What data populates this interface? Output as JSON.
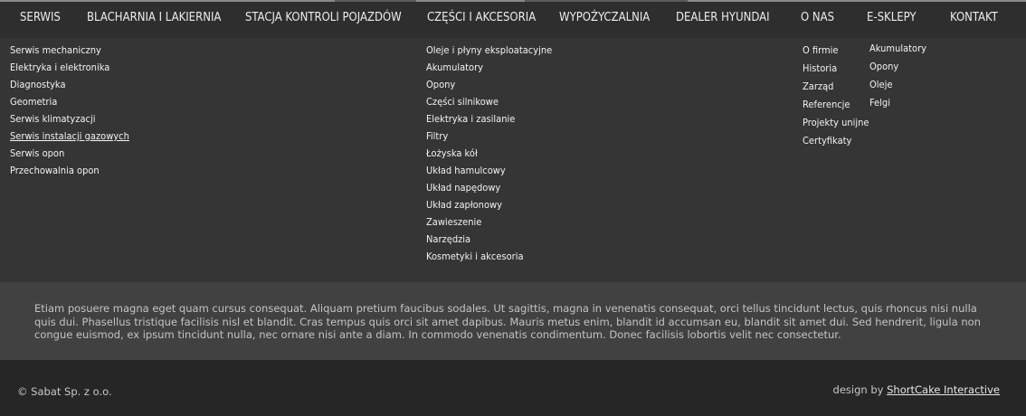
{
  "nav": {
    "items": [
      {
        "label": "SERWIS"
      },
      {
        "label": "BLACHARNIA  I LAKIERNIA"
      },
      {
        "label": "STACJA KONTROLI POJAZDÓW"
      },
      {
        "label": "CZĘŚCI I AKCESORIA"
      },
      {
        "label": "WYPOŻYCZALNIA"
      },
      {
        "label": "DEALER HYUNDAI"
      },
      {
        "label": "O NAS"
      },
      {
        "label": "E-SKLEPY"
      },
      {
        "label": "KONTAKT"
      }
    ]
  },
  "menu": {
    "serwis": [
      "Serwis mechaniczny",
      "Elektryka i elektronika",
      "Diagnostyka",
      "Geometria",
      "Serwis klimatyzacji",
      "Serwis instalacji gazowych",
      "Serwis opon",
      "Przechowalnia opon"
    ],
    "czesci": [
      "Oleje i płyny eksploatacyjne",
      "Akumulatory",
      "Opony",
      "Części silnikowe",
      "Elektryka i zasilanie",
      "Filtry",
      "Łożyska kół",
      "Układ hamulcowy",
      "Układ napędowy",
      "Układ zapłonowy",
      "Zawieszenie",
      "Narzędzia",
      "Kosmetyki i akcesoria"
    ],
    "o_nas": [
      "O firmie",
      "Historia",
      "Zarząd",
      "Referencje",
      "Projekty unijne",
      "Certyfikaty"
    ],
    "e_sklepy": [
      "Akumulatory",
      "Opony",
      "Oleje",
      "Felgi"
    ]
  },
  "lorem": "Etiam posuere magna eget quam cursus consequat. Aliquam pretium faucibus sodales. Ut sagittis, magna in venenatis consequat, orci tellus tincidunt lectus, quis rhoncus nisi nulla quis dui. Phasellus tristique facilisis nisl et blandit. Cras tempus quis orci sit amet dapibus. Mauris metus enim, blandit id accumsan eu, blandit sit amet dui. Sed hendrerit, ligula non congue euismod, ex ipsum tincidunt nulla, nec ornare nisi ante a diam. In commodo venenatis condimentum. Donec facilisis lobortis velit nec consectetur.",
  "footer": {
    "copyright": "© Sabat Sp. z o.o.",
    "design_prefix": "design by ",
    "design_link": "ShortCake Interactive"
  },
  "colors": {
    "nav_bg": "#2e2e2e",
    "menu_bg": "#353535",
    "lorem_bg": "#414141",
    "footer_bg": "#262626"
  }
}
